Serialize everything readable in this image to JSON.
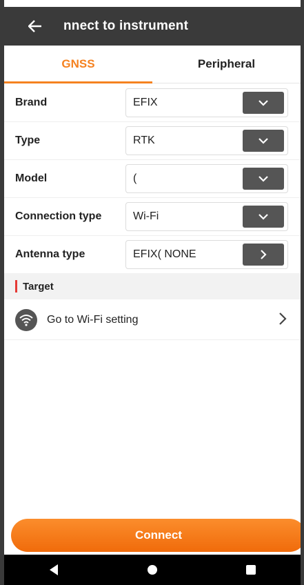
{
  "appbar": {
    "title": "nnect to instrument",
    "back_icon": "arrow-left-icon"
  },
  "tabs": [
    {
      "label": "GNSS",
      "active": true
    },
    {
      "label": "Peripheral",
      "active": false
    }
  ],
  "form": [
    {
      "label": "Brand",
      "value": "EFIX",
      "control": "dropdown"
    },
    {
      "label": "Type",
      "value": "RTK",
      "control": "dropdown"
    },
    {
      "label": "Model",
      "value": "(",
      "control": "dropdown"
    },
    {
      "label": "Connection type",
      "value": "Wi-Fi",
      "control": "dropdown"
    },
    {
      "label": "Antenna type",
      "value": "EFIX( NONE",
      "control": "arrow"
    }
  ],
  "section": {
    "title": "Target"
  },
  "wifi": {
    "label": "Go to Wi-Fi setting"
  },
  "connect": {
    "label": "Connect"
  },
  "colors": {
    "accent": "#f58220",
    "section_bar": "#e53935",
    "appbar": "#3a3a3a"
  }
}
